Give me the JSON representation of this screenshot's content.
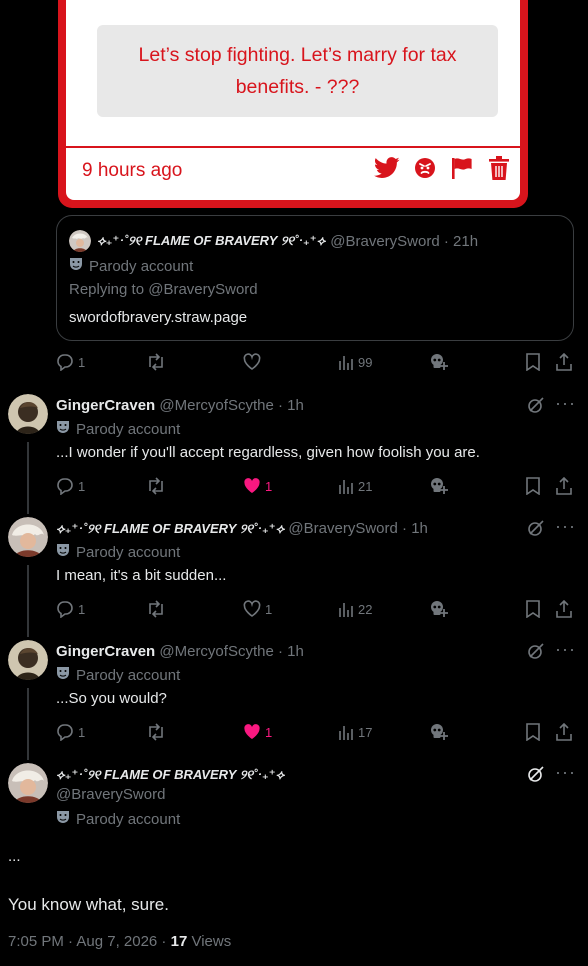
{
  "card": {
    "quote": "Let’s stop fighting. Let’s marry for tax benefits. - ???",
    "time": "9 hours ago",
    "icons": [
      "twitter-bird-icon",
      "angry-face-icon",
      "flag-icon",
      "trash-icon"
    ],
    "accent": "#d8141c"
  },
  "quoted_tweet": {
    "display_name": "⟡₊⁺‧˚୨୧ FLAME OF BRAVERY ୨୧˚‧₊⁺⟡",
    "handle": "@BraverySword",
    "time": "21h",
    "parody": "Parody account",
    "replying": "Replying to @BraverySword",
    "text": "swordofbravery.straw.page",
    "stats": {
      "replies": "1",
      "views": "99"
    }
  },
  "tweets": [
    {
      "name": "GingerCraven",
      "handle": "@MercyofScythe",
      "time": "1h",
      "parody": "Parody account",
      "text": "...I wonder if you'll accept regardless, given how foolish you are.",
      "replies": "1",
      "likes": "1",
      "views": "21",
      "liked": true
    },
    {
      "name": "⟡₊⁺‧˚୨୧ FLAME OF BRAVERY ୨୧˚‧₊⁺⟡",
      "handle": "@BraverySword",
      "time": "1h",
      "parody": "Parody account",
      "text": "I mean, it's a bit sudden...",
      "replies": "1",
      "likes": "1",
      "views": "22",
      "liked": false
    },
    {
      "name": "GingerCraven",
      "handle": "@MercyofScythe",
      "time": "1h",
      "parody": "Parody account",
      "text": "...So you would?",
      "replies": "1",
      "likes": "1",
      "views": "17",
      "liked": true
    }
  ],
  "main_tweet": {
    "name": "⟡₊⁺‧˚୨୧ FLAME OF BRAVERY ୨୧˚‧₊⁺⟡",
    "handle": "@BraverySword",
    "parody": "Parody account",
    "text_1": "...",
    "text_2": "You know what, sure.",
    "time": "7:05 PM · Aug 7, 2026 ·",
    "views_count": "17",
    "views_label": "Views"
  },
  "colors": {
    "like": "#f91880",
    "muted": "#71767b",
    "text": "#e7e9ea"
  }
}
